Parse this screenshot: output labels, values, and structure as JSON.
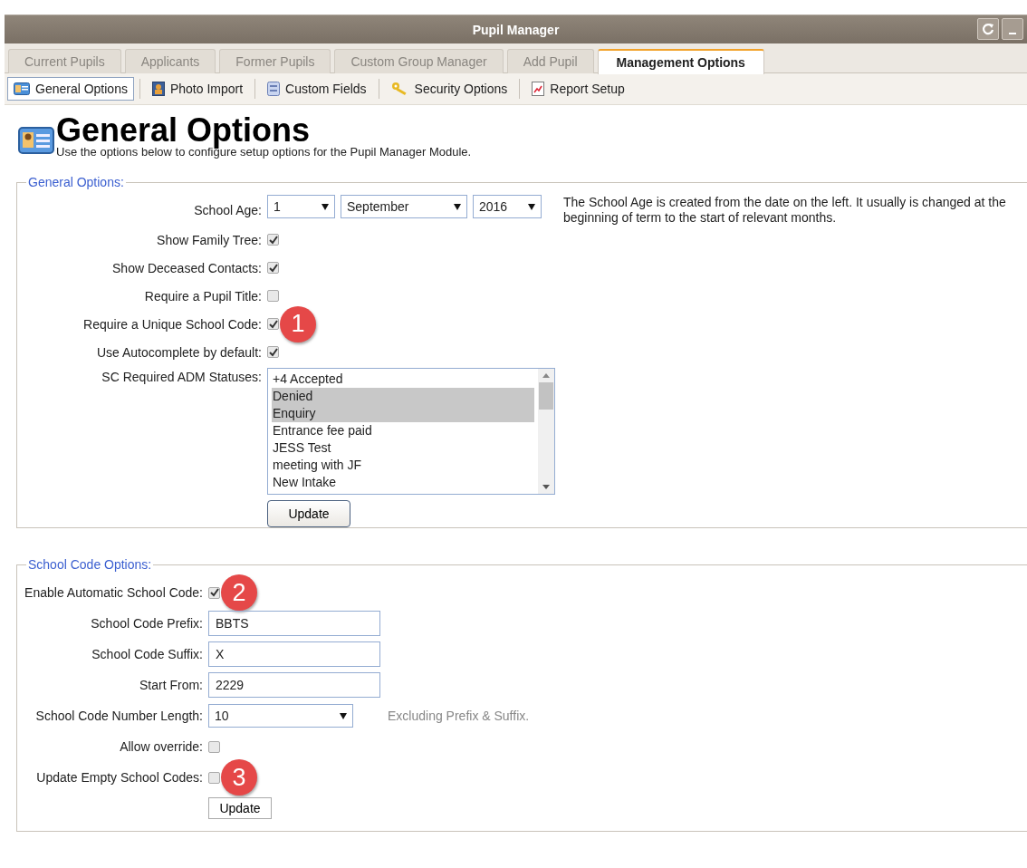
{
  "window": {
    "title": "Pupil Manager"
  },
  "tabs": [
    {
      "label": "Current Pupils",
      "selected": false
    },
    {
      "label": "Applicants",
      "selected": false
    },
    {
      "label": "Former Pupils",
      "selected": false
    },
    {
      "label": "Custom Group Manager",
      "selected": false
    },
    {
      "label": "Add Pupil",
      "selected": false
    },
    {
      "label": "Management Options",
      "selected": true
    }
  ],
  "toolbar": [
    {
      "label": "General Options",
      "selected": true
    },
    {
      "label": "Photo Import",
      "selected": false
    },
    {
      "label": "Custom Fields",
      "selected": false
    },
    {
      "label": "Security Options",
      "selected": false
    },
    {
      "label": "Report Setup",
      "selected": false
    }
  ],
  "heading": "General Options",
  "description": "Use the options below to configure setup options for the Pupil Manager Module.",
  "general_options": {
    "legend": "General Options:",
    "school_age": {
      "label": "School Age:",
      "day": "1",
      "month": "September",
      "year": "2016",
      "note": "The School Age is created from the date on the left. It usually is changed at the beginning of term to the start of relevant months."
    },
    "checkboxes": [
      {
        "label": "Show Family Tree:",
        "checked": true
      },
      {
        "label": "Show Deceased Contacts:",
        "checked": true
      },
      {
        "label": "Require a Pupil Title:",
        "checked": false
      },
      {
        "label": "Require a Unique School Code:",
        "checked": true,
        "badge": "1"
      },
      {
        "label": "Use Autocomplete by default:",
        "checked": true
      }
    ],
    "statuses": {
      "label": "SC Required ADM Statuses:",
      "items": [
        {
          "text": "+4 Accepted",
          "selected": false
        },
        {
          "text": "Denied",
          "selected": true
        },
        {
          "text": "Enquiry",
          "selected": true
        },
        {
          "text": "Entrance fee paid",
          "selected": false
        },
        {
          "text": "JESS Test",
          "selected": false
        },
        {
          "text": "meeting with JF",
          "selected": false
        },
        {
          "text": "New Intake",
          "selected": false
        }
      ]
    },
    "button": "Update"
  },
  "school_code_options": {
    "legend": "School Code Options:",
    "rows": [
      {
        "kind": "checkbox",
        "label": "Enable Automatic School Code:",
        "checked": true,
        "badge": "2"
      },
      {
        "kind": "text",
        "label": "School Code Prefix:",
        "value": "BBTS"
      },
      {
        "kind": "text",
        "label": "School Code Suffix:",
        "value": "X"
      },
      {
        "kind": "text",
        "label": "Start From:",
        "value": "2229"
      },
      {
        "kind": "select",
        "label": "School Code Number Length:",
        "value": "10",
        "note": "Excluding Prefix & Suffix."
      },
      {
        "kind": "checkbox",
        "label": "Allow override:",
        "checked": false
      },
      {
        "kind": "checkbox",
        "label": "Update Empty School Codes:",
        "checked": false,
        "badge": "3"
      }
    ],
    "button": "Update"
  }
}
